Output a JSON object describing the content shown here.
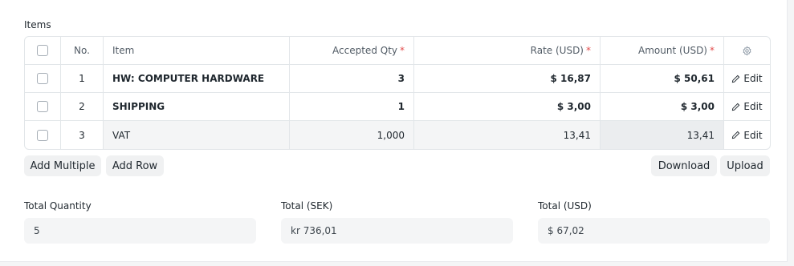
{
  "section_label": "Items",
  "table": {
    "headers": {
      "no": "No.",
      "item": "Item",
      "accepted_qty": "Accepted Qty",
      "rate": "Rate (USD)",
      "amount": "Amount (USD)",
      "required_mark": "*"
    },
    "rows": [
      {
        "no": "1",
        "item": "HW: COMPUTER HARDWARE",
        "qty": "3",
        "rate": "$ 16,87",
        "amount": "$ 50,61",
        "edit": "Edit"
      },
      {
        "no": "2",
        "item": "SHIPPING",
        "qty": "1",
        "rate": "$ 3,00",
        "amount": "$ 3,00",
        "edit": "Edit"
      },
      {
        "no": "3",
        "item": "VAT",
        "qty": "1,000",
        "rate": "13,41",
        "amount": "13,41",
        "edit": "Edit"
      }
    ]
  },
  "buttons": {
    "add_multiple": "Add Multiple",
    "add_row": "Add Row",
    "download": "Download",
    "upload": "Upload"
  },
  "totals": {
    "quantity_label": "Total Quantity",
    "quantity_value": "5",
    "sek_label": "Total (SEK)",
    "sek_value": "kr 736,01",
    "usd_label": "Total (USD)",
    "usd_value": "$ 67,02"
  },
  "icons": {
    "settings": "gear-icon",
    "edit": "pencil-icon"
  },
  "colors": {
    "required": "#e24c4c",
    "border": "#e2e6e9",
    "field_bg": "#f4f5f6"
  }
}
